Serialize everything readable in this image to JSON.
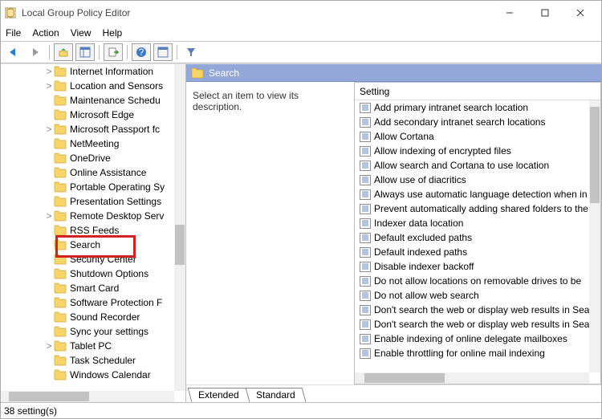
{
  "window": {
    "title": "Local Group Policy Editor"
  },
  "menu": {
    "file": "File",
    "action": "Action",
    "view": "View",
    "help": "Help"
  },
  "tree": {
    "items": [
      {
        "label": "Internet Information",
        "exp": ">"
      },
      {
        "label": "Location and Sensors",
        "exp": ">"
      },
      {
        "label": "Maintenance Schedu",
        "exp": ""
      },
      {
        "label": "Microsoft Edge",
        "exp": ""
      },
      {
        "label": "Microsoft Passport fc",
        "exp": ">"
      },
      {
        "label": "NetMeeting",
        "exp": ""
      },
      {
        "label": "OneDrive",
        "exp": ""
      },
      {
        "label": "Online Assistance",
        "exp": ""
      },
      {
        "label": "Portable Operating Sy",
        "exp": ""
      },
      {
        "label": "Presentation Settings",
        "exp": ""
      },
      {
        "label": "Remote Desktop Serv",
        "exp": ">"
      },
      {
        "label": "RSS Feeds",
        "exp": ""
      },
      {
        "label": "Search",
        "exp": "",
        "hilite": true
      },
      {
        "label": "Security Center",
        "exp": ""
      },
      {
        "label": "Shutdown Options",
        "exp": ""
      },
      {
        "label": "Smart Card",
        "exp": ""
      },
      {
        "label": "Software Protection F",
        "exp": ""
      },
      {
        "label": "Sound Recorder",
        "exp": ""
      },
      {
        "label": "Sync your settings",
        "exp": ""
      },
      {
        "label": "Tablet PC",
        "exp": ">"
      },
      {
        "label": "Task Scheduler",
        "exp": ""
      },
      {
        "label": "Windows Calendar",
        "exp": ""
      }
    ]
  },
  "details": {
    "title": "Search",
    "desc": "Select an item to view its description.",
    "col": "Setting",
    "items": [
      "Add primary intranet search location",
      "Add secondary intranet search locations",
      "Allow Cortana",
      "Allow indexing of encrypted files",
      "Allow search and Cortana to use location",
      "Allow use of diacritics",
      "Always use automatic language detection when in",
      "Prevent automatically adding shared folders to the",
      "Indexer data location",
      "Default excluded paths",
      "Default indexed paths",
      "Disable indexer backoff",
      "Do not allow locations on removable drives to be ",
      "Do not allow web search",
      "Don't search the web or display web results in Sea",
      "Don't search the web or display web results in Sea",
      "Enable indexing of online delegate mailboxes",
      "Enable throttling for online mail indexing"
    ]
  },
  "tabs": {
    "extended": "Extended",
    "standard": "Standard"
  },
  "status": "38 setting(s)"
}
